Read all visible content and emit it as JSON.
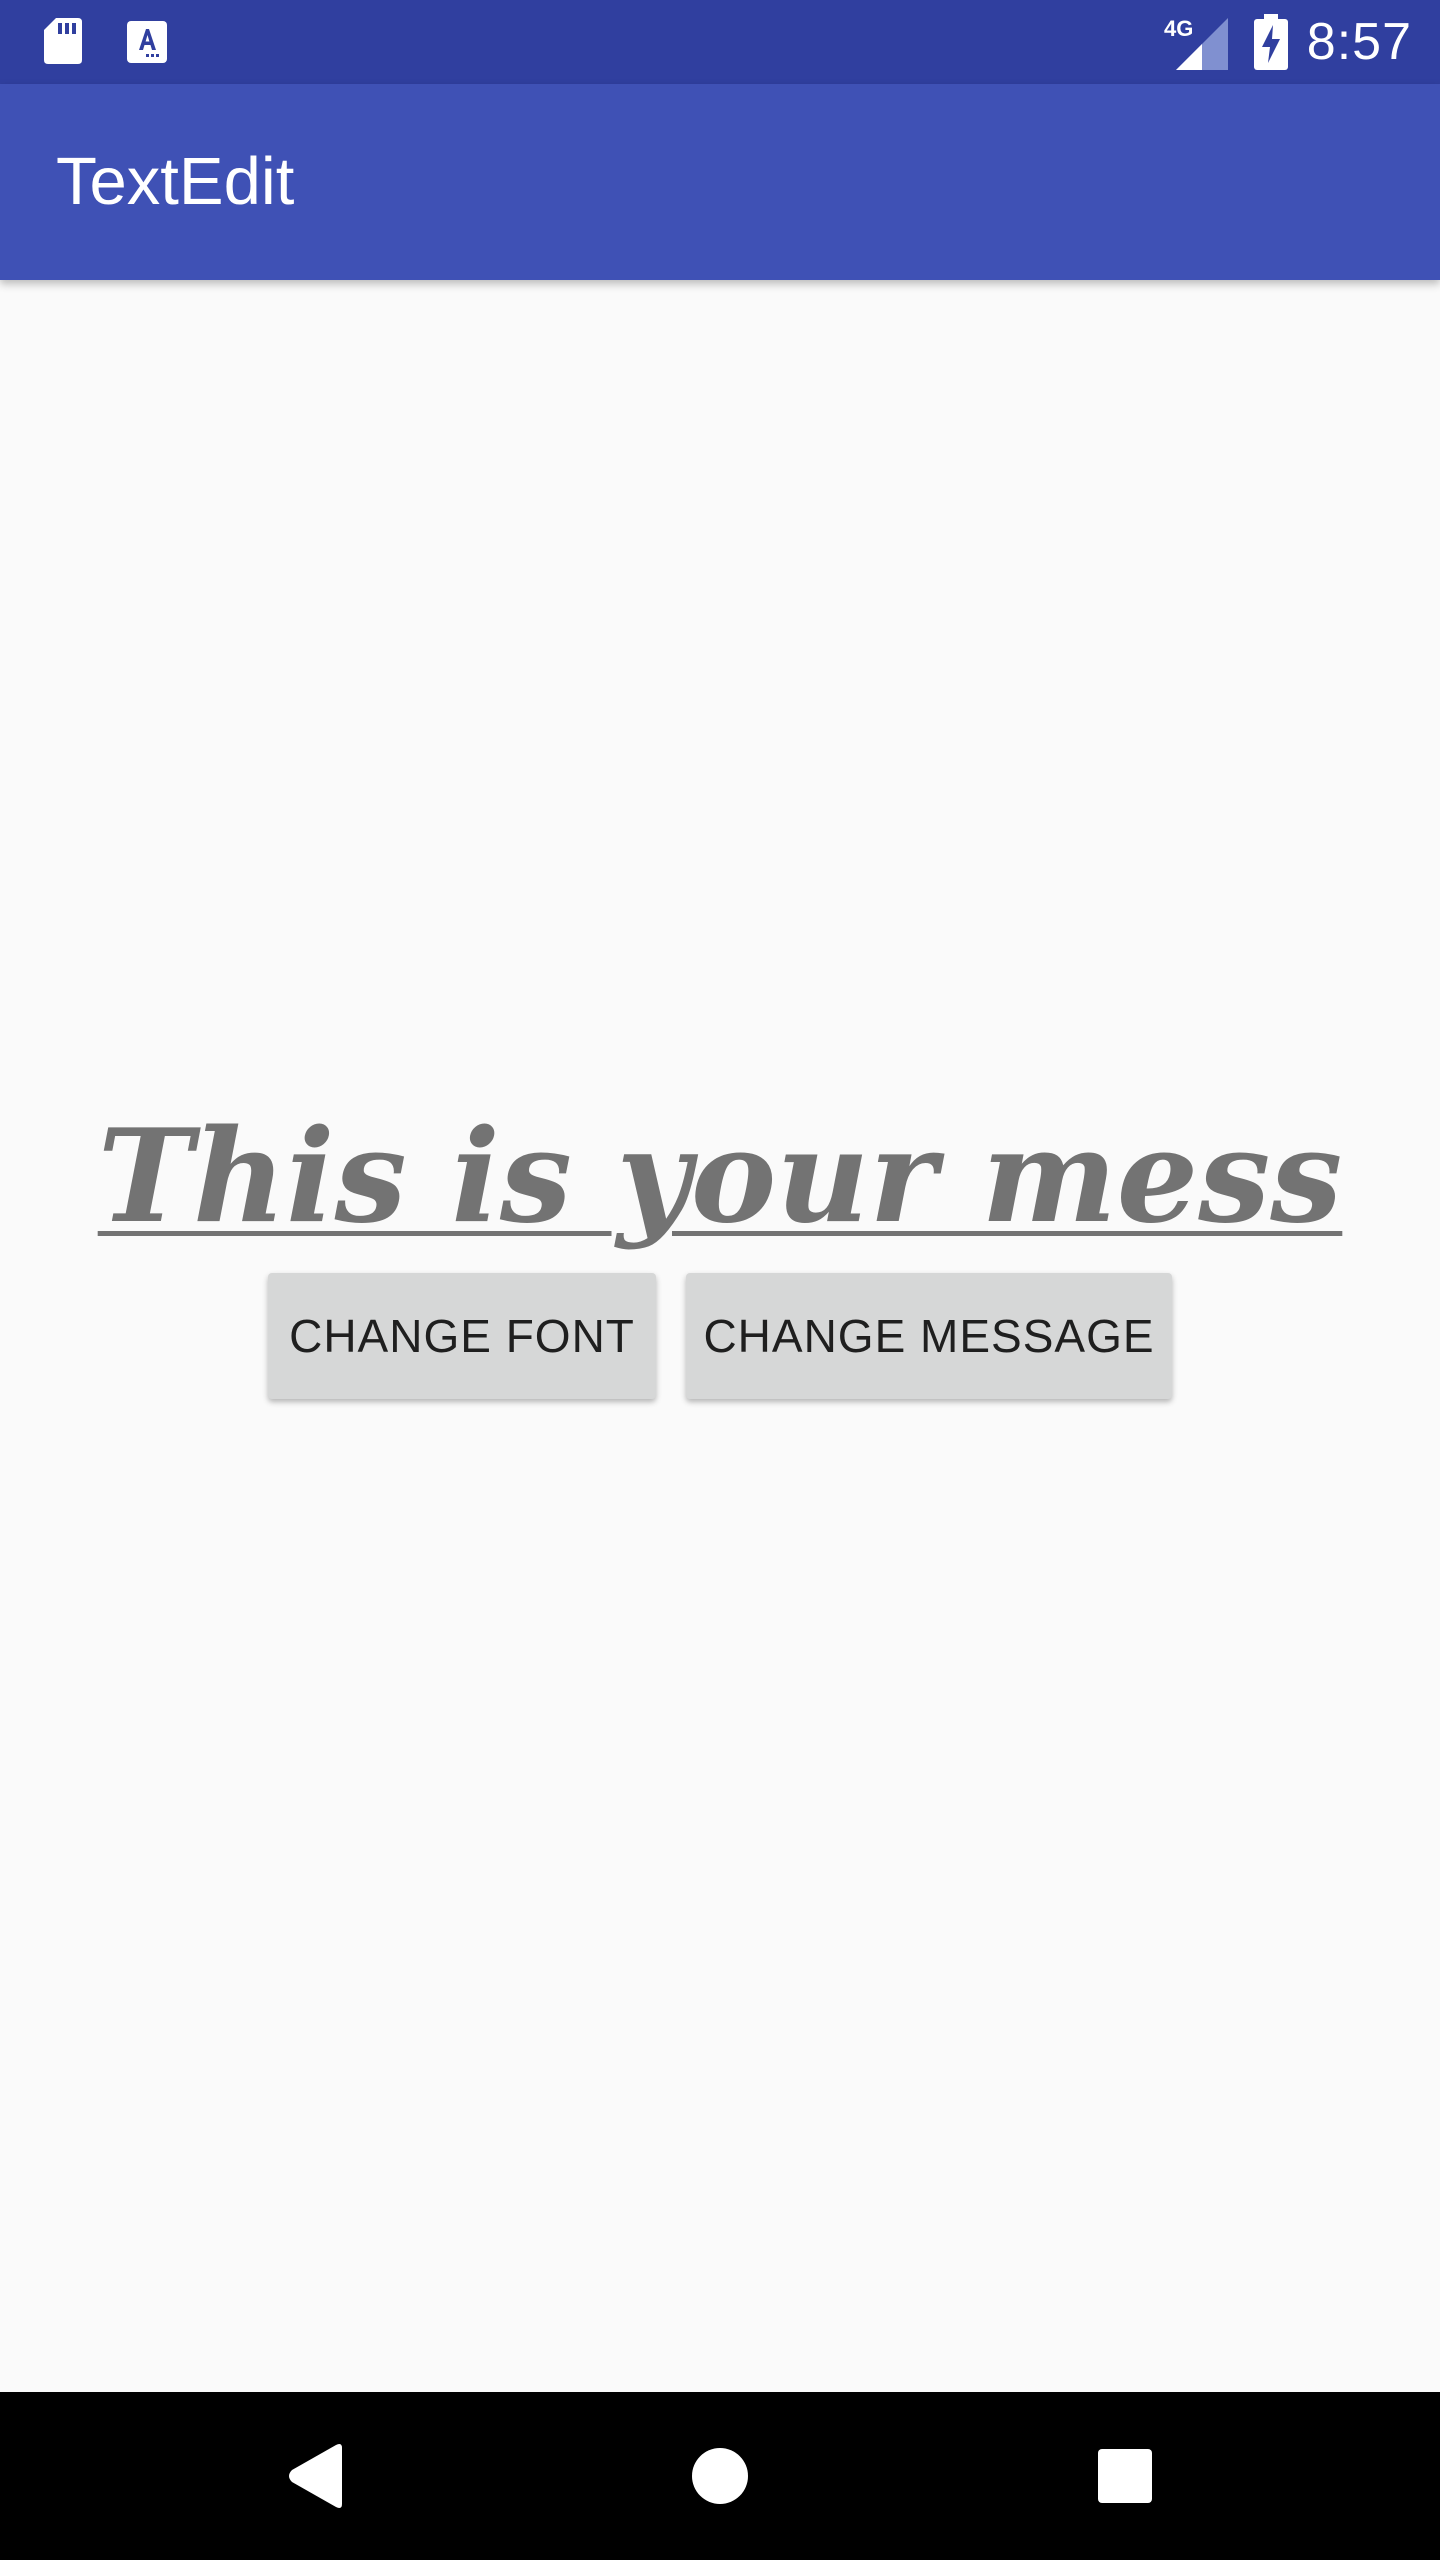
{
  "status_bar": {
    "time": "8:57",
    "network_label": "4G",
    "icons": [
      "sd-card-icon",
      "keyboard-a-icon",
      "signal-4g-icon",
      "battery-charging-icon"
    ]
  },
  "app_bar": {
    "title": "TextEdit"
  },
  "main": {
    "message": "This is your mess",
    "buttons": {
      "change_font": "CHANGE FONT",
      "change_message": "CHANGE MESSAGE"
    }
  },
  "nav_bar": {
    "icons": [
      "back-icon",
      "home-icon",
      "recents-icon"
    ]
  },
  "colors": {
    "status_bar": "#303f9f",
    "app_bar": "#3f51b5",
    "background": "#fafafa",
    "message_text": "#737373",
    "button_bg": "#d6d7d7",
    "nav_bar": "#000000"
  }
}
